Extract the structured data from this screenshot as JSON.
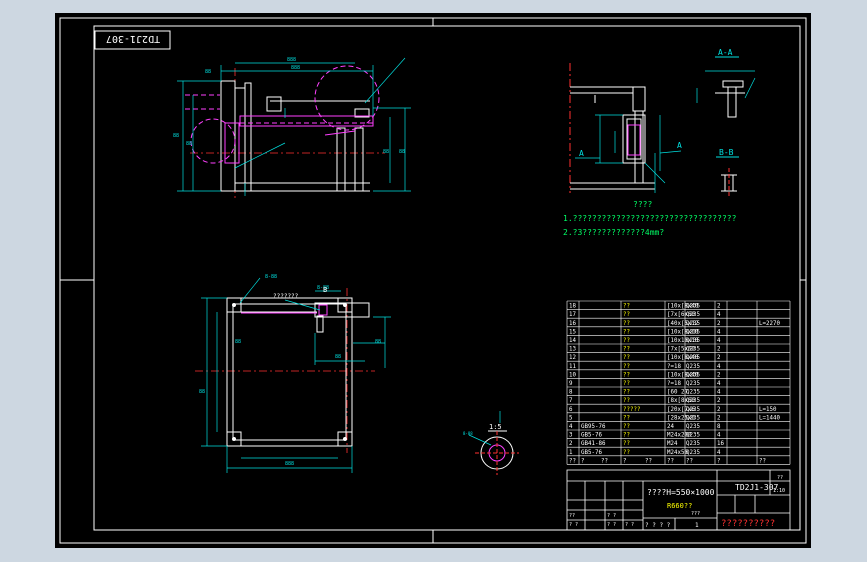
{
  "drawing": {
    "stamp": "TD2J1-307",
    "section_aa": "A-A",
    "section_bb": "B-B",
    "arrow_a": "A",
    "detail_scale": "1:5",
    "note_label_b": "B",
    "tolerance_note": "???????",
    "notes_title": "????",
    "note_1": "1.??????????????????????????????????",
    "note_2": "2.?3?????????????4mm?"
  },
  "bom": {
    "rows": [
      {
        "no": "18",
        "std": "",
        "name": "??",
        "spec": "[10x[8x40",
        "mat": "Q235",
        "qty": "2",
        "note": ""
      },
      {
        "no": "17",
        "std": "",
        "name": "??",
        "spec": "[7x[6x60",
        "mat": "Q235",
        "qty": "4",
        "note": ""
      },
      {
        "no": "16",
        "std": "",
        "name": "??",
        "spec": "[40x[5x12",
        "mat": "Q235",
        "qty": "2",
        "note": "L=2270"
      },
      {
        "no": "15",
        "std": "",
        "name": "??",
        "spec": "[10x[8x60",
        "mat": "Q235",
        "qty": "4",
        "note": ""
      },
      {
        "no": "14",
        "std": "",
        "name": "??",
        "spec": "[10x10x10",
        "mat": "Q235",
        "qty": "4",
        "note": ""
      },
      {
        "no": "13",
        "std": "",
        "name": "??",
        "spec": "[7x[5x60",
        "mat": "Q235",
        "qty": "2",
        "note": ""
      },
      {
        "no": "12",
        "std": "",
        "name": "??",
        "spec": "[10x[8x40",
        "mat": "Q235",
        "qty": "2",
        "note": ""
      },
      {
        "no": "11",
        "std": "",
        "name": "??",
        "spec": "?=18",
        "mat": "Q235",
        "qty": "4",
        "note": ""
      },
      {
        "no": "10",
        "std": "",
        "name": "??",
        "spec": "[10x[8x40",
        "mat": "Q235",
        "qty": "2",
        "note": ""
      },
      {
        "no": "9",
        "std": "",
        "name": "??",
        "spec": "?=18",
        "mat": "Q235",
        "qty": "4",
        "note": ""
      },
      {
        "no": "8",
        "std": "",
        "name": "??",
        "spec": "[60 2?",
        "mat": "Q235",
        "qty": "4",
        "note": ""
      },
      {
        "no": "7",
        "std": "",
        "name": "??",
        "spec": "[8x[8x60",
        "mat": "Q235",
        "qty": "2",
        "note": ""
      },
      {
        "no": "6",
        "std": "",
        "name": "?????",
        "spec": "[20x[7x6",
        "mat": "Q235",
        "qty": "2",
        "note": "L=150"
      },
      {
        "no": "5",
        "std": "",
        "name": "??",
        "spec": "[28x25x6",
        "mat": "Q235",
        "qty": "2",
        "note": "L=1440"
      },
      {
        "no": "4",
        "std": "GB95-76",
        "name": "??",
        "spec": "24",
        "mat": "Q235",
        "qty": "8",
        "note": ""
      },
      {
        "no": "3",
        "std": "GB5-76",
        "name": "??",
        "spec": "M24x200",
        "mat": "Q235",
        "qty": "4",
        "note": ""
      },
      {
        "no": "2",
        "std": "GB41-86",
        "name": "??",
        "spec": "M24",
        "mat": "Q235",
        "qty": "16",
        "note": ""
      },
      {
        "no": "1",
        "std": "GB5-76",
        "name": "??",
        "spec": "M24x50",
        "mat": "Q235",
        "qty": "4",
        "note": ""
      }
    ],
    "header": [
      "??",
      "?",
      "??",
      "?",
      "??",
      "??",
      "??",
      "?",
      "??"
    ]
  },
  "title_block": {
    "product": "????H=550×1000",
    "sub": "R660??",
    "drawing_no": "TD2J1-307",
    "scale": "1:10",
    "qm": "??",
    "sheet": "1",
    "company": "??????????",
    "footer_left": "? ? ? ?",
    "footer_qm": "???",
    "label_qm1": "??",
    "label_qm2": "? ?",
    "label_qm3": "? ?",
    "label_qm4": "? ?",
    "label_qm5": "? ?"
  }
}
